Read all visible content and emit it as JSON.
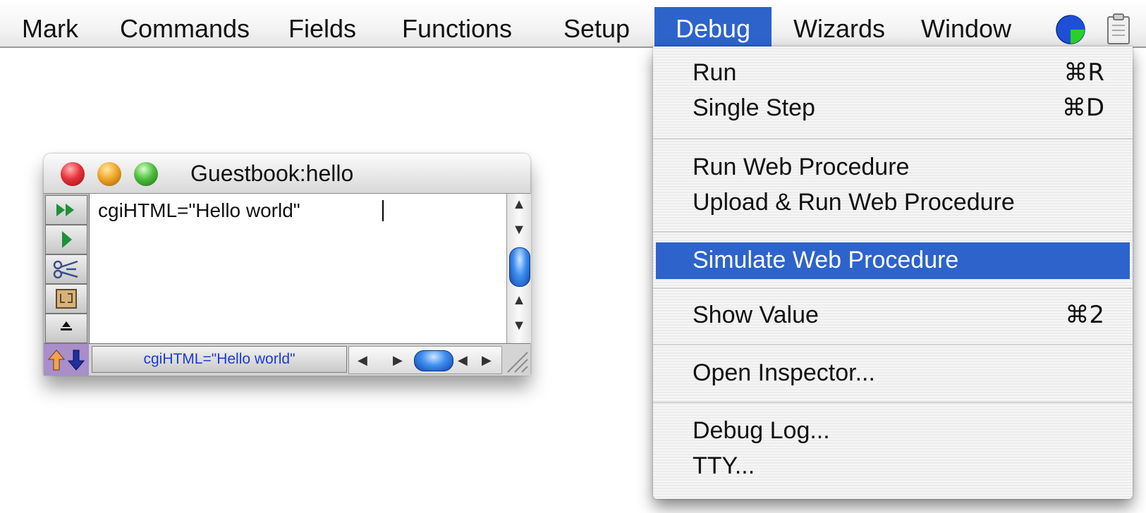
{
  "menubar": {
    "items": [
      {
        "label": "Mark"
      },
      {
        "label": "Commands"
      },
      {
        "label": "Fields"
      },
      {
        "label": "Functions"
      },
      {
        "label": "Setup"
      },
      {
        "label": "Debug",
        "active": true
      },
      {
        "label": "Wizards"
      },
      {
        "label": "Window"
      }
    ],
    "status_icon": "pie-status-icon",
    "clipboard_icon": "clipboard-icon"
  },
  "debug_menu": {
    "items": [
      {
        "label": "Run",
        "shortcut": "⌘R"
      },
      {
        "label": "Single Step",
        "shortcut": "⌘D"
      },
      {
        "label": "Run Web Procedure",
        "shortcut": ""
      },
      {
        "label": "Upload & Run Web Procedure",
        "shortcut": ""
      },
      {
        "label": "Simulate Web Procedure",
        "shortcut": "",
        "highlighted": true
      },
      {
        "label": "Show Value",
        "shortcut": "⌘2"
      },
      {
        "label": "Open Inspector...",
        "shortcut": ""
      },
      {
        "label": "Debug Log...",
        "shortcut": ""
      },
      {
        "label": "TTY...",
        "shortcut": ""
      }
    ]
  },
  "procedure_window": {
    "title": "Guestbook:hello",
    "code": "cgiHTML=\"Hello world\"",
    "status_field": "cgiHTML=\"Hello world\"",
    "tools": [
      "fast-forward-icon",
      "play-icon",
      "scissors-icon",
      "split-icon",
      "extra-tool-icon"
    ]
  },
  "colors": {
    "selection": "#2d63cb",
    "status_text": "#1b3cd6",
    "nav_arrows_bg": "#a98ec9"
  }
}
